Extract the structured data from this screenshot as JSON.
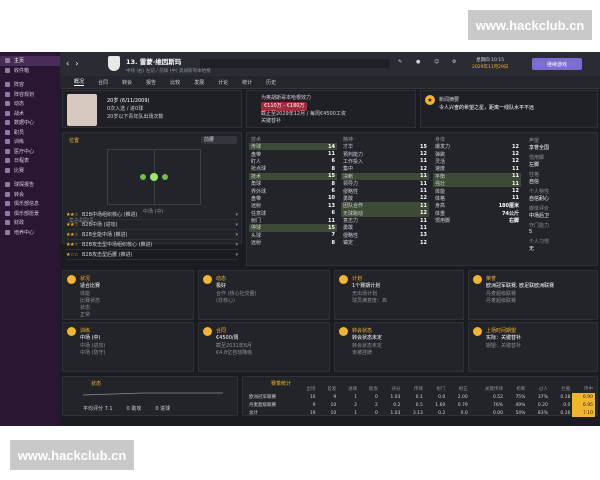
{
  "watermark": "www.hackclub.cn",
  "sidebar": {
    "items": [
      {
        "label": "主页",
        "icon": "home-icon"
      },
      {
        "label": "收件箱",
        "icon": "inbox-icon"
      },
      {
        "label": "阵容",
        "icon": "squad-icon"
      },
      {
        "label": "阵容规划",
        "icon": "plan-icon"
      },
      {
        "label": "动态",
        "icon": "dynamics-icon"
      },
      {
        "label": "战术",
        "icon": "tactics-icon"
      },
      {
        "label": "数据中心",
        "icon": "data-icon"
      },
      {
        "label": "职员",
        "icon": "staff-icon"
      },
      {
        "label": "训练",
        "icon": "training-icon"
      },
      {
        "label": "医疗中心",
        "icon": "medical-icon"
      },
      {
        "label": "日程表",
        "icon": "calendar-icon"
      },
      {
        "label": "比赛",
        "icon": "match-icon"
      },
      {
        "label": "球探报告",
        "icon": "scout-icon"
      },
      {
        "label": "转会",
        "icon": "transfer-icon"
      },
      {
        "label": "俱乐部信息",
        "icon": "club-info-icon"
      },
      {
        "label": "俱乐部愿景",
        "icon": "vision-icon"
      },
      {
        "label": "财政",
        "icon": "finance-icon"
      },
      {
        "label": "培养中心",
        "icon": "youth-icon"
      }
    ]
  },
  "topbar": {
    "player_number_name": "13. 雷蒙·维因斯玛",
    "player_sub": "中场 (右) 左前 / 前锋 (中) 奥胡斯哥本哈根",
    "date_line1": "星期四 10:15",
    "date_line2": "2029年11月29日",
    "continue_label": "继续游戏"
  },
  "tabs": [
    "概况",
    "合同",
    "转会",
    "报告",
    "比较",
    "发展",
    "计论",
    "统计",
    "历史"
  ],
  "profile": {
    "age_label": "20岁 (6/11/2009)",
    "caps_label": "0次入选 / 进0球",
    "contract_label": "20岁以下青年队出场次数",
    "club_top": "为奥胡斯哥本哈根效力",
    "value_range": "€110万 - €180万",
    "contract_until": "截止至2029年12月 / 每周€4500工资",
    "squad_status": "关键替补",
    "interest_title": "新闻摘要",
    "interest_text": "令人兴奋的希望之星，距离一线队水平不远"
  },
  "position": {
    "label": "位置",
    "role_btn": "前腰",
    "pitch_caption": "中场 (中)",
    "roles_title": "角色和职责",
    "roles": [
      {
        "name": "B2B中场组织核心 (推进)",
        "stars": "★★☆"
      },
      {
        "name": "B2B中场 (进攻)",
        "stars": "★★☆"
      },
      {
        "name": "B2B全能中场 (推进)",
        "stars": "★★☆"
      },
      {
        "name": "B2B攻击型中场组织核心 (推进)",
        "stars": "★★☆"
      },
      {
        "name": "B2B攻击型后腰 (推进)",
        "stars": "★☆☆"
      }
    ]
  },
  "attributes": {
    "technical_title": "技术",
    "mental_title": "精神",
    "physical_title": "身体",
    "technical": [
      {
        "n": "传球",
        "v": "14"
      },
      {
        "n": "盘带",
        "v": "11"
      },
      {
        "n": "盯人",
        "v": "6"
      },
      {
        "n": "抢点球",
        "v": "8"
      },
      {
        "n": "技术",
        "v": "15"
      },
      {
        "n": "角球",
        "v": "8"
      },
      {
        "n": "界外球",
        "v": "6"
      },
      {
        "n": "盘带",
        "v": "10"
      },
      {
        "n": "远射",
        "v": "13"
      },
      {
        "n": "任意球",
        "v": "6"
      },
      {
        "n": "射门",
        "v": "11"
      },
      {
        "n": "停球",
        "v": "15"
      },
      {
        "n": "头球",
        "v": "7"
      },
      {
        "n": "远射",
        "v": "8"
      }
    ],
    "mental": [
      {
        "n": "才华",
        "v": "15"
      },
      {
        "n": "预判能力",
        "v": "12"
      },
      {
        "n": "工作投入",
        "v": "11"
      },
      {
        "n": "集中",
        "v": "12"
      },
      {
        "n": "决断",
        "v": "11"
      },
      {
        "n": "领导力",
        "v": "11"
      },
      {
        "n": "侵略性",
        "v": "11"
      },
      {
        "n": "勇敢",
        "v": "12"
      },
      {
        "n": "团队合作",
        "v": "11"
      },
      {
        "n": "无球跑动",
        "v": "12"
      },
      {
        "n": "意志力",
        "v": "11"
      },
      {
        "n": "勇敢",
        "v": "11"
      },
      {
        "n": "侵略性",
        "v": "13"
      },
      {
        "n": "镇定",
        "v": "12"
      }
    ],
    "physical": [
      {
        "n": "爆发力",
        "v": "12"
      },
      {
        "n": "弹跳",
        "v": "12"
      },
      {
        "n": "灵活",
        "v": "12"
      },
      {
        "n": "速度",
        "v": "11"
      },
      {
        "n": "平衡",
        "v": "11"
      },
      {
        "n": "强壮",
        "v": "11"
      },
      {
        "n": "体能",
        "v": "12"
      },
      {
        "n": "体格",
        "v": "11"
      },
      {
        "n": "身高",
        "v": "180厘米"
      },
      {
        "n": "体重",
        "v": "74公斤"
      },
      {
        "n": "惯用脚",
        "v": "右脚"
      }
    ],
    "right_col": [
      {
        "h": "声望",
        "v": "享誉全国"
      },
      {
        "h": "惯用脚",
        "v": "左脚"
      },
      {
        "h": "性格",
        "v": "自信"
      },
      {
        "h": "个人特性",
        "v": "自信耐心"
      },
      {
        "h": "媒体评价",
        "v": "中场后卫"
      },
      {
        "h": "守门能力",
        "v": "5"
      },
      {
        "h": "个人习惯",
        "v": "无"
      }
    ]
  },
  "cards_row1": [
    {
      "title": "状况",
      "main": "适合比赛",
      "sub1": "体能",
      "sub2": "比赛状态",
      "sub3": "状态",
      "sub4": "正常"
    },
    {
      "title": "动态",
      "main": "极好",
      "sub1": "合作 (核心社交圈)",
      "sub2": "(非核心)"
    },
    {
      "title": "计划",
      "main": "1个赛期计划",
      "sub1": "无出场计划",
      "sub2": "球员满意度：高"
    },
    {
      "title": "荣誉",
      "main": "欧洲冠军联赛, 欧足联欧洲联赛",
      "sub1": "丹麦超级联赛",
      "sub2": "丹麦超级联赛"
    }
  ],
  "cards_row2": [
    {
      "title": "训练",
      "main": "中场 (中)",
      "sub1": "中场 (进攻)",
      "sub2": "中场 (防守)"
    },
    {
      "title": "合同",
      "main": "€4500/周",
      "sub1": "截至2031年6月",
      "sub2": "€4.8亿自动降级"
    },
    {
      "title": "转会状态",
      "main": "转会状态未定",
      "sub1": "转会状态未定",
      "sub2": "未被挂牌"
    },
    {
      "title": "上场时间期望",
      "main": "实际：关键替补",
      "sub1": "期望：关键替补"
    }
  ],
  "form": {
    "title": "状态",
    "l1": "平均评分 7.1",
    "l2": "0 助攻",
    "l3": "0 进球"
  },
  "stats": {
    "title": "赛季统计",
    "headers": [
      "出场",
      "首发",
      "进球",
      "助攻",
      "评分",
      "传球",
      "射门",
      "射正",
      "关键传球",
      "抢断",
      "过人",
      "拦截",
      "传中"
    ],
    "rows": [
      {
        "comp": "欧洲冠军联赛",
        "cells": [
          "10",
          "9",
          "1",
          "0",
          "1.03",
          "0.1",
          "0.0",
          "2.00",
          "0.52",
          "75%",
          "37%",
          "0.18",
          "6.90"
        ]
      },
      {
        "comp": "丹麦超级联赛",
        "cells": [
          "9",
          "10",
          "2",
          "2",
          "0.2",
          "0.5",
          "1.60",
          "0.79",
          "76%",
          "49%",
          "0.20",
          "0.0",
          "6.95"
        ]
      },
      {
        "comp": "总计",
        "cells": [
          "19",
          "10",
          "1",
          "0",
          "1.03",
          "3.13",
          "0.2",
          "0.0",
          "0.00",
          "54%",
          "83%",
          "0.16",
          "7.10"
        ]
      }
    ]
  },
  "colors": {
    "accent": "#f2b52c",
    "sidebar": "#2a1532",
    "bg": "#1b1c21",
    "highlight": "#3d4a35",
    "continue": "#7c6bd1"
  }
}
